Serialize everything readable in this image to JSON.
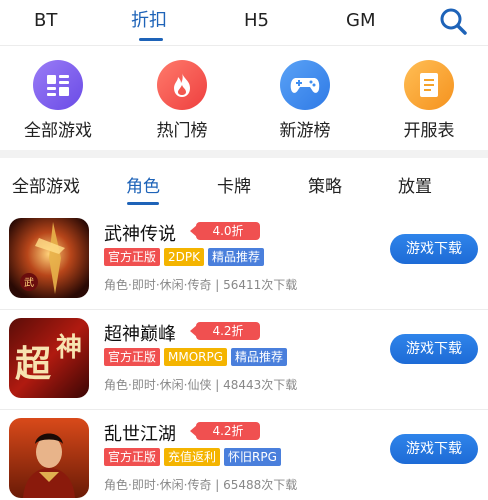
{
  "top_tabs": [
    "BT",
    "折扣",
    "H5",
    "GM"
  ],
  "categories": [
    {
      "label": "全部游戏",
      "icon": "grid-icon",
      "color": "#7b5cf0"
    },
    {
      "label": "热门榜",
      "icon": "flame-icon",
      "color": "#f2584f"
    },
    {
      "label": "新游榜",
      "icon": "gamepad-icon",
      "color": "#3f8ef0"
    },
    {
      "label": "开服表",
      "icon": "document-icon",
      "color": "#f5a32a"
    }
  ],
  "genre_tabs": [
    "全部游戏",
    "角色",
    "卡牌",
    "策略",
    "放置"
  ],
  "games": [
    {
      "name": "武神传说",
      "discount": "4.0折",
      "tags": [
        "官方正版",
        "2DPK",
        "精品推荐"
      ],
      "meta": "角色·即时·休闲·传奇 | 56411次下载",
      "button": "游戏下载"
    },
    {
      "name": "超神巅峰",
      "discount": "4.2折",
      "tags": [
        "官方正版",
        "MMORPG",
        "精品推荐"
      ],
      "meta": "角色·即时·休闲·仙侠 | 48443次下载",
      "button": "游戏下载"
    },
    {
      "name": "乱世江湖",
      "discount": "4.2折",
      "tags": [
        "官方正版",
        "充值返利",
        "怀旧RPG"
      ],
      "meta": "角色·即时·休闲·传奇 | 65488次下载",
      "button": "游戏下载"
    }
  ],
  "colors": {
    "accent": "#1e63b8",
    "tag_red": "#f05050",
    "tag_orange": "#f4b400",
    "tag_blue": "#4a7fdc",
    "button": "#2a78e4"
  }
}
